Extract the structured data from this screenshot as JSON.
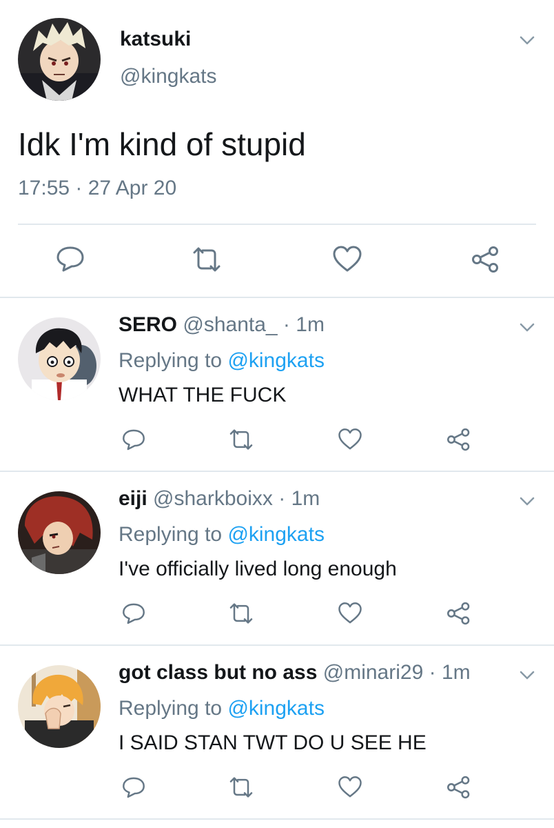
{
  "main_tweet": {
    "name": "katsuki",
    "handle": "@kingkats",
    "text": "Idk I'm kind of stupid",
    "timestamp": "17:55 · 27 Apr 20",
    "avatar_icon": "avatar-katsuki",
    "actions": [
      "reply-icon",
      "retweet-icon",
      "like-icon",
      "share-icon"
    ]
  },
  "replies": [
    {
      "name": "SERO",
      "handle": "@shanta_",
      "time": "1m",
      "replying_prefix": "Replying to",
      "replying_to": "@kingkats",
      "text": "WHAT THE FUCK"
    },
    {
      "name": "eiji",
      "handle": "@sharkboixx",
      "time": "1m",
      "replying_prefix": "Replying to",
      "replying_to": "@kingkats",
      "text": "I've officially lived long enough"
    },
    {
      "name": "got class but no ass",
      "handle": "@minari29",
      "time": "1m",
      "replying_prefix": "Replying to",
      "replying_to": "@kingkats",
      "text": "I SAID STAN TWT DO U SEE HE"
    }
  ],
  "colors": {
    "text": "#14171a",
    "secondary": "#657786",
    "link": "#1da1f2",
    "divider": "#e1e8ed"
  }
}
